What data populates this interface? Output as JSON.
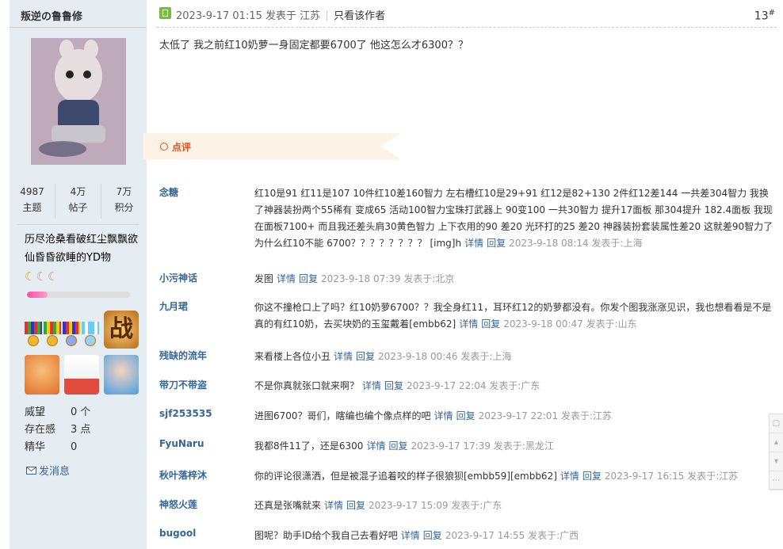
{
  "author": {
    "name": "叛逆の鲁鲁修",
    "stats": [
      {
        "value": "4987",
        "label": "主题"
      },
      {
        "value": "4万",
        "label": "帖子"
      },
      {
        "value": "7万",
        "label": "积分"
      }
    ],
    "signature": "历尽沧桑看破红尘飘飘欲仙昏昏欲睡的YD物",
    "moons": "☾☾☾",
    "level_progress_percent": 20,
    "medal_big_text": "战",
    "info": [
      {
        "key": "威望",
        "value": "0 个"
      },
      {
        "key": "存在感",
        "value": "3 点"
      },
      {
        "key": "精华",
        "value": "0"
      }
    ],
    "send_message_label": "发消息"
  },
  "post": {
    "date": "2023-9-17 01:15",
    "posted_in": "发表于 江苏",
    "only_author_label": "只看该作者",
    "floor": "13",
    "floor_mark": "#",
    "content": "太低了  我之前红10奶萝一身固定都要6700了  他这怎么才6300？？"
  },
  "dianping": {
    "label": "点评"
  },
  "comments": [
    {
      "user": "念糖",
      "text": "红10是91 红11是107 10件红10差160智力 左右槽红10是29+91 红12是82+130 2件红12差144 一共差304智力 我换了神器装扮两个55稀有 变成65 活动100智力宝珠打武器上 90变100 一共30智力 提升17面板 那304提升 182.4面板 我现在面板7100+ 而且我还差头肩30黄色智力 上下衣用的90 差20 光环打的25 差20 神器装扮套装属性差20 这就差90智力了 为什么红10不能 6700？？？？？？？？ [img]h",
      "detail": "详情",
      "reply": "回复",
      "time": "2023-9-18 08:14 发表于:上海"
    },
    {
      "user": "小污神话",
      "text": "发图",
      "detail": "详情",
      "reply": "回复",
      "time": "2023-9-18 07:39 发表于:北京"
    },
    {
      "user": "九月珺",
      "text": "你这不撞枪口上了吗？红10奶萝6700？？我全身红11，耳环红12的奶萝都没有。你发个图我涨涨见识，我也想看看是不是真的有红10奶，去买块奶的玉玺戴着[embb62]",
      "detail": "详情",
      "reply": "回复",
      "time": "2023-9-18 00:47 发表于:山东"
    },
    {
      "user": "残缺的流年",
      "text": "来看楼上各位小丑",
      "detail": "详情",
      "reply": "回复",
      "time": "2023-9-18 00:46 发表于:上海"
    },
    {
      "user": "带刀不带盗",
      "text": "不是你真就张口就来啊？",
      "detail": "详情",
      "reply": "回复",
      "time": "2023-9-17 22:04 发表于:广东"
    },
    {
      "user": "sjf253535",
      "text": "进图6700？哥们，瞎编也编个像点样的吧",
      "detail": "详情",
      "reply": "回复",
      "time": "2023-9-17 22:01 发表于:江苏"
    },
    {
      "user": "FyuNaru",
      "text": "我都8件11了，还是6300",
      "detail": "详情",
      "reply": "回复",
      "time": "2023-9-17 17:39 发表于:黑龙江"
    },
    {
      "user": "秋叶落梓沐",
      "text": "你的评论很潇洒，但是被混子追着咬的样子很狼狈[embb59][embb62]",
      "detail": "详情",
      "reply": "回复",
      "time": "2023-9-17 16:15 发表于:江苏"
    },
    {
      "user": "神怒火莲",
      "text": "还真是张嘴就来",
      "detail": "详情",
      "reply": "回复",
      "time": "2023-9-17 15:09 发表于:广东"
    },
    {
      "user": "bugool",
      "text": "图呢？助手ID给个我自己去看好吧",
      "detail": "详情",
      "reply": "回复",
      "time": "2023-9-17 14:55 发表于:广西"
    }
  ],
  "colors": {
    "sidebar_bg": "#e5edf2",
    "link": "#336699",
    "dianping_accent": "#e05020",
    "online_icon": "#73bf3a"
  }
}
